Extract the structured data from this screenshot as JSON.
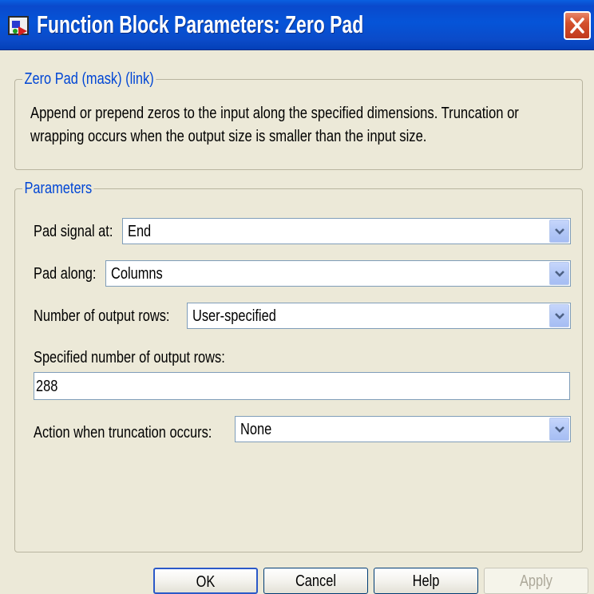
{
  "window": {
    "title": "Function Block Parameters: Zero Pad"
  },
  "mask_group": {
    "legend": "Zero Pad (mask) (link)",
    "description_lines": [
      "Append or prepend zeros to the input along the specified dimensions.  Truncation or",
      "wrapping occurs when the output size is smaller than the input size."
    ]
  },
  "parameters_group": {
    "legend": "Parameters",
    "pad_signal_at": {
      "label": "Pad signal at:",
      "value": "End"
    },
    "pad_along": {
      "label": "Pad along:",
      "value": "Columns"
    },
    "number_of_output_rows": {
      "label": "Number of output rows:",
      "value": "User-specified"
    },
    "specified_rows": {
      "label": "Specified number of output rows:",
      "value": "288"
    },
    "truncation_action": {
      "label": "Action when truncation occurs:",
      "value": "None"
    }
  },
  "buttons": {
    "ok": "OK",
    "cancel": "Cancel",
    "help": "Help",
    "apply": "Apply"
  },
  "icons": {
    "title": "simulink-block-icon",
    "close": "close-icon",
    "dropdown": "chevron-down-icon"
  },
  "colors": {
    "titlebar": "#0554d8",
    "legend_text": "#0046d5",
    "close_button": "#d4502c",
    "window_bg": "#ece9d8"
  }
}
